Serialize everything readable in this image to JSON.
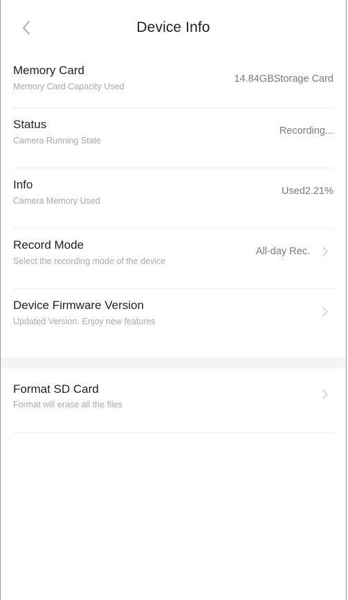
{
  "header": {
    "title": "Device Info"
  },
  "items": [
    {
      "label": "Memory Card",
      "sub": "Memory Card Capacity Used",
      "value": "14.84GBStorage Card"
    },
    {
      "label": "Status",
      "sub": "Camera Running State",
      "value": "Recording..."
    },
    {
      "label": "Info",
      "sub": "Camera Memory Used",
      "value": "Used2.21%"
    },
    {
      "label": "Record Mode",
      "sub": "Select the recording mode of the device",
      "value": "All-day Rec."
    },
    {
      "label": "Device Firmware Version",
      "sub": "Updated Version. Enjoy new features"
    },
    {
      "label": "Format SD Card",
      "sub": "Format will erase all the files"
    }
  ],
  "icons": {
    "back": "chevron-left-icon",
    "row_arrow": "chevron-right-icon"
  },
  "colors": {
    "separator": "#ededed",
    "section_gap": "#f4f4f4",
    "secondary_text": "#a8a8a8",
    "value_text": "#7a7a7a"
  }
}
